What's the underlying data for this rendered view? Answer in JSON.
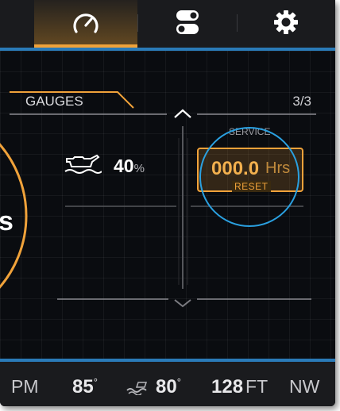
{
  "colors": {
    "accent": "#f0a23a",
    "blue": "#2a7bb8",
    "circle": "#2aa0e0"
  },
  "nav": {
    "tabs": [
      {
        "icon": "gauge-icon",
        "active": true
      },
      {
        "icon": "toggles-icon",
        "active": false
      },
      {
        "icon": "gear-icon",
        "active": false
      }
    ]
  },
  "header": {
    "title": "GAUGES",
    "page": "3/3"
  },
  "oil": {
    "icon": "oil-pressure-icon",
    "value": "40",
    "unit": "%"
  },
  "left_gauge": {
    "partial_text": "s"
  },
  "service": {
    "title": "SERVICE",
    "value": "000.0",
    "unit": "Hrs",
    "reset_label": "RESET"
  },
  "status_bar": {
    "rpm_unit": "PM",
    "temp1_value": "85",
    "temp1_unit": "°",
    "water_icon": "water-temp-icon",
    "temp2_value": "80",
    "temp2_unit": "°",
    "depth_value": "128",
    "depth_unit": "FT",
    "heading": "NW"
  }
}
